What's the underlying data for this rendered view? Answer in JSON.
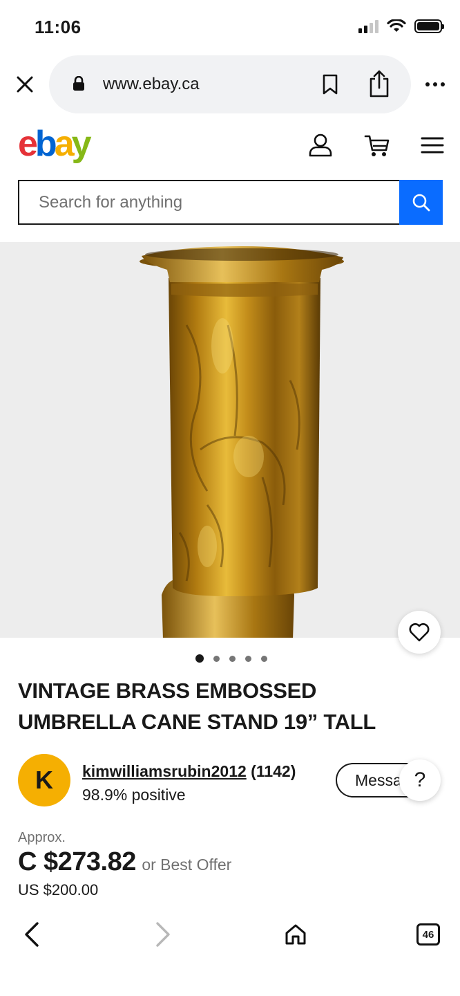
{
  "status_bar": {
    "time": "11:06"
  },
  "browser": {
    "url": "www.ebay.ca",
    "tab_count": "46"
  },
  "header": {
    "logo": {
      "l1": "e",
      "l2": "b",
      "l3": "a",
      "l4": "y"
    },
    "icons": [
      "account-icon",
      "cart-icon",
      "menu-icon"
    ]
  },
  "search": {
    "placeholder": "Search for anything",
    "value": ""
  },
  "gallery": {
    "image_count": 5,
    "active_index": 0
  },
  "listing": {
    "title": "VINTAGE BRASS EMBOSSED UMBRELLA CANE STAND 19” TALL",
    "seller": {
      "avatar_letter": "K",
      "name": "kimwilliamsrubin2012",
      "feedback_count": "(1142)",
      "rating": "98.9% positive",
      "message_label": "Message"
    },
    "price": {
      "approx_label": "Approx.",
      "amount": "C $273.82",
      "offer_note": "or Best Offer",
      "original": "US $200.00"
    }
  },
  "colors": {
    "accent_blue": "#0a6cff",
    "avatar_yellow": "#f5af02",
    "gallery_bg": "#ededed"
  },
  "help": {
    "label": "?"
  }
}
